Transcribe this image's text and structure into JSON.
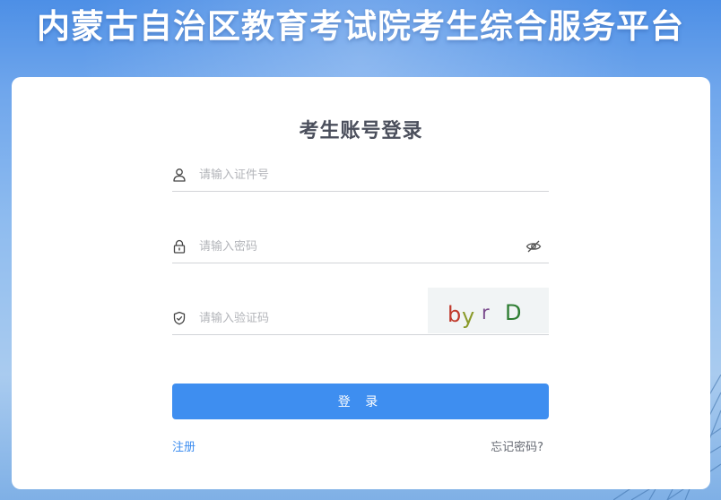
{
  "header": {
    "title": "内蒙古自治区教育考试院考生综合服务平台"
  },
  "login": {
    "heading": "考生账号登录",
    "id_field": {
      "placeholder": "请输入证件号",
      "value": "",
      "icon": "user-icon"
    },
    "password_field": {
      "placeholder": "请输入密码",
      "value": "",
      "icon": "lock-icon",
      "toggle_icon": "eye-hidden-icon"
    },
    "captcha_field": {
      "placeholder": "请输入验证码",
      "value": "",
      "icon": "shield-check-icon"
    },
    "captcha_image": {
      "chars": [
        "b",
        "y",
        "r",
        "D"
      ],
      "colors": [
        "#c0392b",
        "#8a9a2a",
        "#7a4a8c",
        "#2e7d32"
      ]
    },
    "submit_label": "登 录",
    "register_label": "注册",
    "forgot_label": "忘记密码?"
  },
  "colors": {
    "primary": "#3e8ef0",
    "heading": "#4b4f5c",
    "background": "#6fa6ec"
  }
}
